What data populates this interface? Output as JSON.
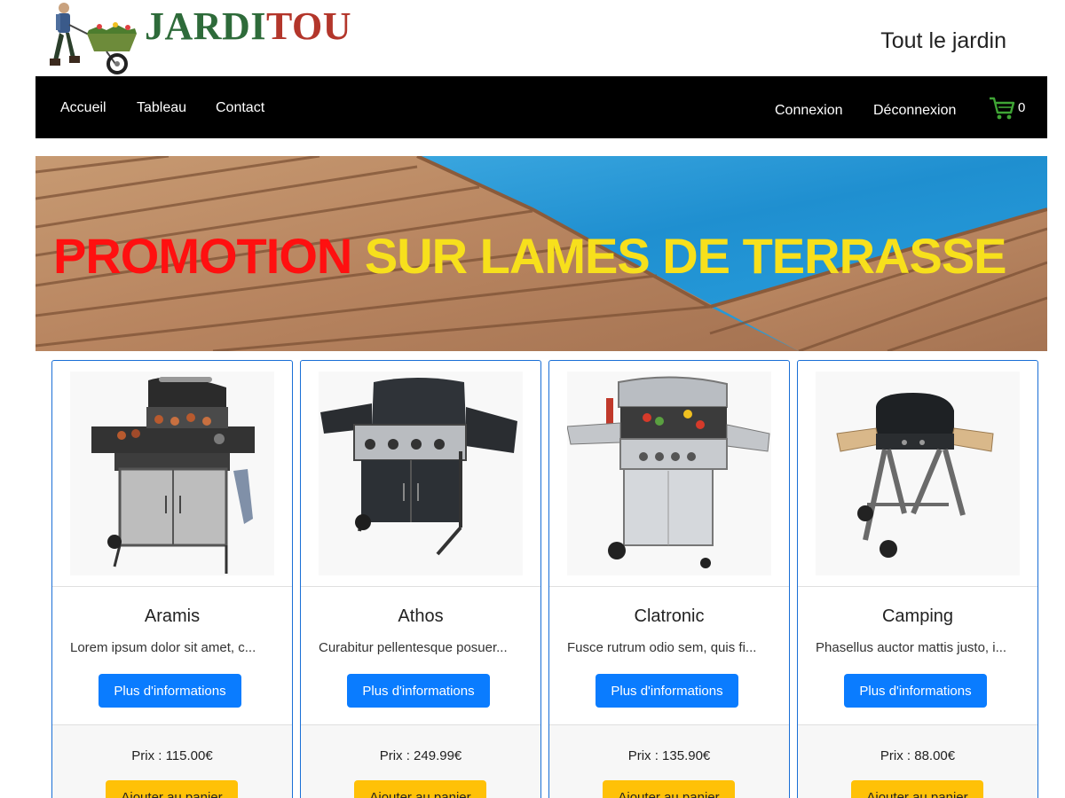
{
  "header": {
    "logo_text_1": "JARDI",
    "logo_text_2": "TOU",
    "tagline": "Tout le jardin"
  },
  "nav": {
    "home": "Accueil",
    "board": "Tableau",
    "contact": "Contact",
    "login": "Connexion",
    "logout": "Déconnexion",
    "cart_count": "0"
  },
  "banner": {
    "word1": "PROMOTION",
    "word2": "SUR LAMES DE TERRASSE"
  },
  "products": [
    {
      "name": "Aramis",
      "desc": "Lorem ipsum dolor sit amet, c...",
      "info_label": "Plus d'informations",
      "price": "Prix : 115.00€",
      "cart_label": "Ajouter au panier"
    },
    {
      "name": "Athos",
      "desc": "Curabitur pellentesque posuer...",
      "info_label": "Plus d'informations",
      "price": "Prix : 249.99€",
      "cart_label": "Ajouter au panier"
    },
    {
      "name": "Clatronic",
      "desc": "Fusce rutrum odio sem, quis fi...",
      "info_label": "Plus d'informations",
      "price": "Prix : 135.90€",
      "cart_label": "Ajouter au panier"
    },
    {
      "name": "Camping",
      "desc": "Phasellus auctor mattis justo, i...",
      "info_label": "Plus d'informations",
      "price": "Prix : 88.00€",
      "cart_label": "Ajouter au panier"
    }
  ],
  "colors": {
    "primary": "#0a7cff",
    "warning": "#ffc107",
    "nav_bg": "#000000",
    "cart_icon": "#3fa535"
  }
}
